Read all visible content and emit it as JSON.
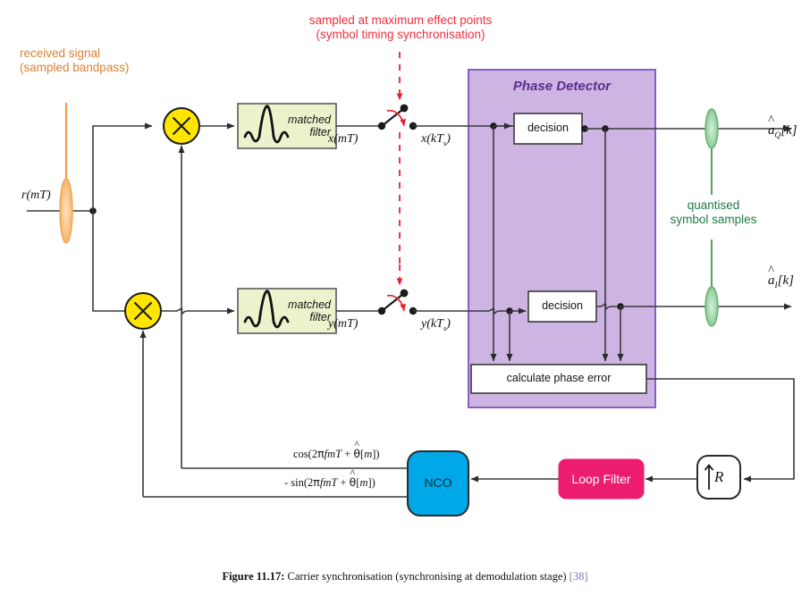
{
  "figure": {
    "caption_number": "Figure 11.17:",
    "caption_text": " Carrier synchronisation (synchronising at demodulation stage) ",
    "caption_reference": "[38]"
  },
  "annotations": {
    "received_signal": {
      "line1": "received signal",
      "line2": "(sampled bandpass)",
      "color": "#e08030"
    },
    "sampling": {
      "line1": "sampled at maximum effect points",
      "line2": "(symbol timing synchronisation)",
      "color": "#f03040"
    },
    "quantised": {
      "line1": "quantised",
      "line2": "symbol samples",
      "color": "#1f7a45"
    }
  },
  "signals": {
    "input": "r(mT)",
    "i_after_filter": "x(mT)",
    "i_after_sampler": "x(kTs)",
    "q_after_filter": "y(mT)",
    "q_after_sampler": "y(kTs)",
    "output_upper": "aQ[k]",
    "output_lower": "aI[k]",
    "nco_cos": "cos(2πf mT + θ[m])",
    "nco_sin": "- sin(2πf mT + θ[m])"
  },
  "blocks": {
    "phase_detector_title": "Phase Detector",
    "matched_filter_line1": "matched",
    "matched_filter_line2": "filter",
    "decision": "decision",
    "calculate_phase_error": "calculate phase error",
    "nco": "NCO",
    "loop_filter": "Loop Filter",
    "upsampler": "R"
  },
  "colors": {
    "mixer_fill": "#ffe500",
    "matched_filter_fill": "#edf2cd",
    "phase_detector_fill": "#cdb4e3",
    "phase_detector_border": "#8b5fbf",
    "nco_fill": "#00a8e8",
    "loop_filter_fill": "#ec1d6e",
    "wire": "#3a3a3a",
    "annotation_red": "#f03040",
    "annotation_orange": "#e08030",
    "annotation_green": "#1f7a45",
    "signal_marker_orange": "#f4a04a",
    "signal_marker_green": "#6fbf7f"
  }
}
